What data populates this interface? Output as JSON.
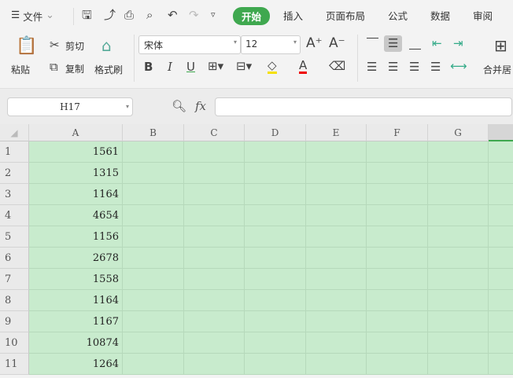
{
  "menu": {
    "file": "文件",
    "tabs": [
      "开始",
      "插入",
      "页面布局",
      "公式",
      "数据",
      "审阅"
    ]
  },
  "ribbon": {
    "paste": "粘贴",
    "cut": "剪切",
    "copy": "复制",
    "format_painter": "格式刷",
    "font_name": "宋体",
    "font_size": "12",
    "merge": "合并居"
  },
  "formula_bar": {
    "name_box": "H17",
    "fx": "fx",
    "value": ""
  },
  "sheet": {
    "columns": [
      "A",
      "B",
      "C",
      "D",
      "E",
      "F",
      "G",
      ""
    ],
    "rows": [
      "1",
      "2",
      "3",
      "4",
      "5",
      "6",
      "7",
      "8",
      "9",
      "10",
      "11"
    ],
    "col_a": [
      "1561",
      "1315",
      "1164",
      "4654",
      "1156",
      "2678",
      "1558",
      "1164",
      "1167",
      "10874",
      "1264"
    ]
  },
  "colors": {
    "accent": "#3fa84f",
    "selection": "#c8ebcd"
  }
}
